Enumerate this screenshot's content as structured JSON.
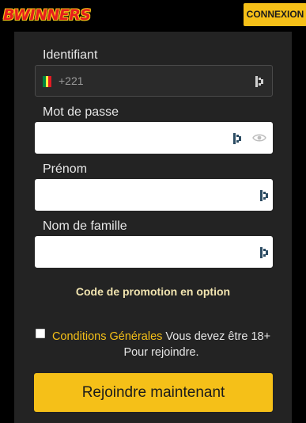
{
  "header": {
    "logo_text": "BWINNERS",
    "login_label": "CONNEXION"
  },
  "form": {
    "username": {
      "label": "Identifiant",
      "prefix": "+221"
    },
    "password": {
      "label": "Mot de passe",
      "value": ""
    },
    "first_name": {
      "label": "Prénom",
      "value": ""
    },
    "last_name": {
      "label": "Nom de famille",
      "value": ""
    },
    "promo_label": "Code de promotion en option",
    "terms": {
      "link": "Conditions Générales",
      "text": " Vous devez être 18+ Pour rejoindre."
    },
    "submit_label": "Rejoindre maintenant"
  },
  "colors": {
    "accent": "#f5c018",
    "background": "#232323",
    "flag": [
      "#00853f",
      "#fdef42",
      "#e31b23"
    ]
  }
}
